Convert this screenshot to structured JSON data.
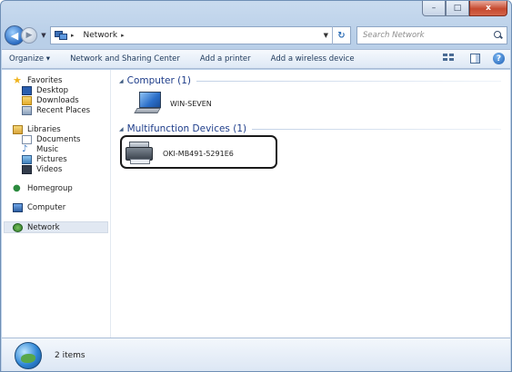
{
  "window": {
    "caption_buttons": {
      "minimize": "–",
      "maximize": "□",
      "close": "x"
    }
  },
  "address_bar": {
    "location": "Network",
    "search_placeholder": "Search Network"
  },
  "toolbar": {
    "organize": "Organize ▾",
    "network_sharing": "Network and Sharing Center",
    "add_printer": "Add a printer",
    "add_wireless": "Add a wireless device"
  },
  "nav_pane": {
    "favorites": "Favorites",
    "desktop": "Desktop",
    "downloads": "Downloads",
    "recent_places": "Recent Places",
    "libraries": "Libraries",
    "documents": "Documents",
    "music": "Music",
    "pictures": "Pictures",
    "videos": "Videos",
    "homegroup": "Homegroup",
    "computer": "Computer",
    "network": "Network"
  },
  "groups": {
    "computer_header": "Computer (1)",
    "computer_item": "WIN-SEVEN",
    "mfd_header": "Multifunction Devices (1)",
    "mfd_item": "OKI-MB491-5291E6"
  },
  "status": {
    "item_count": "2 items"
  },
  "icons": {
    "back": "back-arrow-icon",
    "forward": "forward-arrow-icon",
    "refresh": "refresh-icon",
    "search": "search-icon",
    "help": "help-icon"
  }
}
